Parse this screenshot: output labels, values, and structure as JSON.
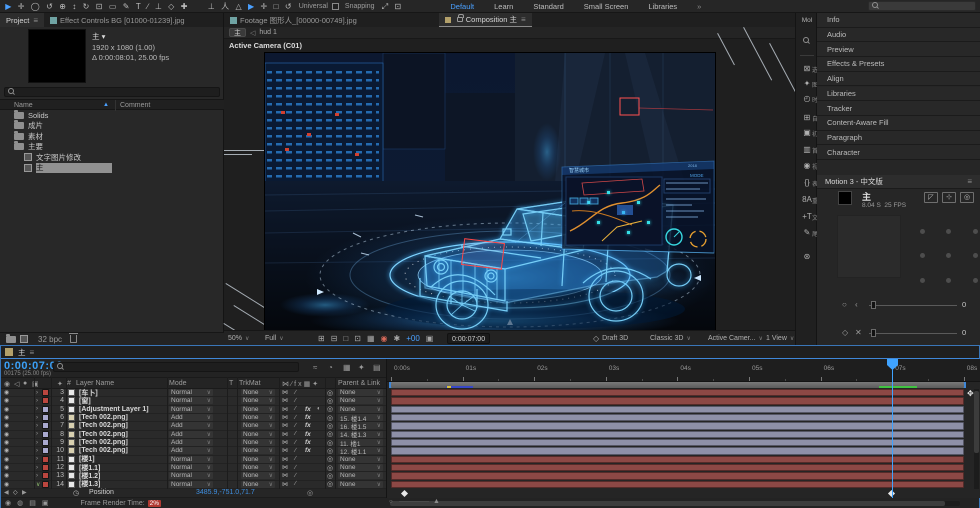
{
  "toolbar": {
    "tools": [
      "selection",
      "hand",
      "zoom",
      "orbit-camera",
      "pan-camera",
      "dolly-camera",
      "rotation",
      "anchor-point",
      "rectangle",
      "pen",
      "type",
      "line",
      "axis",
      "shape",
      "puppet"
    ],
    "mode_tools": [
      "local-axis",
      "world-axis",
      "view-axis",
      "move",
      "add",
      "box",
      "reset"
    ],
    "universal_label": "Universal",
    "snapping_label": "Snapping",
    "workspaces": [
      "Default",
      "Learn",
      "Standard",
      "Small Screen",
      "Libraries"
    ],
    "active_workspace": "Default",
    "overflow_icon": "»"
  },
  "project": {
    "tab": "Project",
    "second_tab": "Effect Controls BG [01000-01239].jpg",
    "selected_name": "主",
    "info_line1": "1920 x 1080 (1.00)",
    "info_line2": "Δ 0:00:08:01, 25.00 fps",
    "columns": {
      "name": "Name",
      "comment": "Comment"
    },
    "items": [
      {
        "label": "Solids",
        "type": "folder",
        "indent": 0
      },
      {
        "label": "成片",
        "type": "folder",
        "indent": 0
      },
      {
        "label": "素材",
        "type": "folder",
        "indent": 0
      },
      {
        "label": "主要",
        "type": "folder",
        "indent": 0,
        "open": true
      },
      {
        "label": "文字图片修改",
        "type": "comp",
        "indent": 1
      },
      {
        "label": "主",
        "type": "comp",
        "indent": 1,
        "selected": true
      }
    ],
    "bit_depth": "32 bpc"
  },
  "viewer": {
    "footage_tab": "Footage 图形人_[00000-00749].jpg",
    "comp_tab": "Composition 主",
    "breadcrumb": {
      "comp": "主",
      "sub": "hud 1"
    },
    "camera_label": "Active Camera (C01)",
    "scene": {
      "hud_title": "智慧城市",
      "hud_mode": "MODE",
      "hud_year": "2018"
    },
    "bottom": {
      "zoom": "50%",
      "resolution": "Full",
      "exposure": "+00",
      "timecode": "0:00:07:00",
      "fast_previews": "Draft 3D",
      "renderer": "Classic 3D",
      "camera": "Active Camer...",
      "views": "1 View"
    }
  },
  "right": {
    "dock_label": "Mol",
    "panels": [
      "Info",
      "Audio",
      "Preview",
      "Effects & Presets",
      "Align",
      "Libraries",
      "Tracker",
      "Content-Aware Fill",
      "Paragraph",
      "Character"
    ],
    "motion": {
      "title": "Motion 3 - 中文版",
      "comp_name": "主",
      "duration": "8.04 S",
      "fps": "25 FPS",
      "value1": "0",
      "value2": "0"
    },
    "strip": [
      {
        "name": "node-icon",
        "label": "选"
      },
      {
        "name": "burst-icon",
        "label": "图"
      },
      {
        "name": "clock-icon",
        "label": "时"
      },
      {
        "name": "grid-icon",
        "label": "自"
      },
      {
        "name": "folder-icon",
        "label": "初"
      },
      {
        "name": "frame-icon",
        "label": "首"
      },
      {
        "name": "eye-icon",
        "label": "视"
      },
      {
        "name": "braces-icon",
        "label": "表"
      },
      {
        "name": "font-icon",
        "label": "重"
      },
      {
        "name": "type-icon",
        "label": "文"
      },
      {
        "name": "vector-icon",
        "label": "尾"
      },
      {
        "name": "gear-icon",
        "label": ""
      }
    ]
  },
  "timeline": {
    "tab": "主",
    "timecode": "0:00:07:00",
    "frame_info": "00175 (25.00 fps)",
    "columns": {
      "layer_name": "Layer Name",
      "mode": "Mode",
      "t": "T",
      "trkmat": "TrkMat",
      "parent": "Parent & Link"
    },
    "layers": [
      {
        "num": 3,
        "name": "[车卜]",
        "icon": "solid",
        "mode": "Normal",
        "trkmat": "None",
        "parent": "None",
        "swatch": "#bb463f",
        "bar": "#8c4845",
        "fx": false,
        "adj": false
      },
      {
        "num": 4,
        "name": "[窗]",
        "icon": "solid",
        "mode": "Normal",
        "trkmat": "None",
        "parent": "None",
        "swatch": "#bb463f",
        "bar": "#8c4845",
        "fx": false,
        "adj": false
      },
      {
        "num": 5,
        "name": "[Adjustment Layer 1]",
        "icon": "solid",
        "mode": "Normal",
        "trkmat": "None",
        "parent": "None",
        "swatch": "#a9a9cf",
        "bar": "#8e90a8",
        "fx": true,
        "adj": true
      },
      {
        "num": 6,
        "name": "[Tech 002.png]",
        "icon": "img",
        "mode": "Add",
        "trkmat": "None",
        "parent": "15. 楼1.4",
        "swatch": "#a9a9cf",
        "bar": "#8e90a8",
        "fx": true,
        "adj": false
      },
      {
        "num": 7,
        "name": "[Tech 002.png]",
        "icon": "img",
        "mode": "Add",
        "trkmat": "None",
        "parent": "16. 楼1.5",
        "swatch": "#a9a9cf",
        "bar": "#8e90a8",
        "fx": true,
        "adj": false
      },
      {
        "num": 8,
        "name": "[Tech 002.png]",
        "icon": "img",
        "mode": "Add",
        "trkmat": "None",
        "parent": "14. 楼1.3",
        "swatch": "#a9a9cf",
        "bar": "#8e90a8",
        "fx": true,
        "adj": false
      },
      {
        "num": 9,
        "name": "[Tech 002.png]",
        "icon": "img",
        "mode": "Add",
        "trkmat": "None",
        "parent": "11. 楼1",
        "swatch": "#a9a9cf",
        "bar": "#8e90a8",
        "fx": true,
        "adj": false
      },
      {
        "num": 10,
        "name": "[Tech 002.png]",
        "icon": "img",
        "mode": "Add",
        "trkmat": "None",
        "parent": "12. 楼1.1",
        "swatch": "#a9a9cf",
        "bar": "#8e90a8",
        "fx": true,
        "adj": false
      },
      {
        "num": 11,
        "name": "[楼1]",
        "icon": "solid",
        "mode": "Normal",
        "trkmat": "None",
        "parent": "None",
        "swatch": "#bb463f",
        "bar": "#8c4845",
        "fx": false,
        "adj": false
      },
      {
        "num": 12,
        "name": "[楼1.1]",
        "icon": "solid",
        "mode": "Normal",
        "trkmat": "None",
        "parent": "None",
        "swatch": "#bb463f",
        "bar": "#8c4845",
        "fx": false,
        "adj": false
      },
      {
        "num": 13,
        "name": "[楼1.2]",
        "icon": "solid",
        "mode": "Normal",
        "trkmat": "None",
        "parent": "None",
        "swatch": "#bb463f",
        "bar": "#8c4845",
        "fx": false,
        "adj": false
      },
      {
        "num": 14,
        "name": "[楼1.3]",
        "icon": "solid",
        "mode": "Normal",
        "trkmat": "None",
        "parent": "None",
        "swatch": "#bb463f",
        "bar": "#8c4845",
        "fx": false,
        "adj": false,
        "open": true
      }
    ],
    "property_row": {
      "name": "Position",
      "value": "3485.9,-751.0,71.7"
    },
    "ruler_labels": [
      "0:00s",
      "01s",
      "02s",
      "03s",
      "04s",
      "05s",
      "06s",
      "07s",
      "08s"
    ],
    "status": {
      "label": "Frame Render Time:",
      "value": "2%"
    }
  }
}
